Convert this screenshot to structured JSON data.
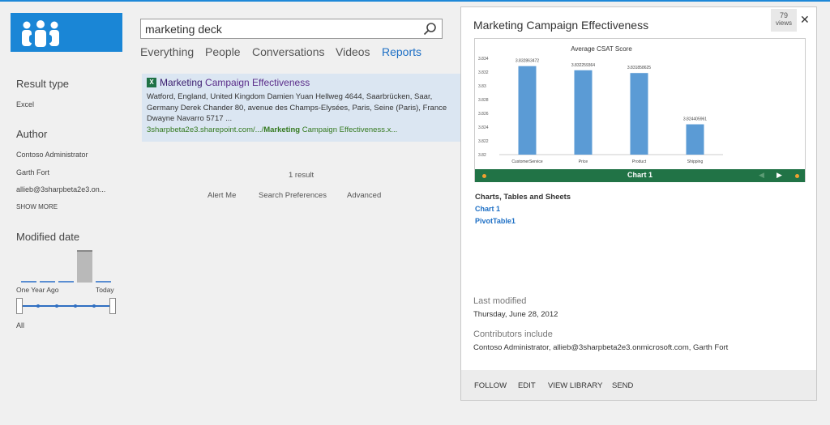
{
  "refiners": {
    "result_type": {
      "heading": "Result type",
      "items": [
        "Excel"
      ]
    },
    "author": {
      "heading": "Author",
      "items": [
        "Contoso Administrator",
        "Garth Fort",
        "allieb@3sharpbeta2e3.on..."
      ],
      "show_more": "SHOW MORE"
    },
    "modified_date": {
      "heading": "Modified date",
      "start_label": "One Year Ago",
      "end_label": "Today",
      "selection": "All",
      "histogram_levels": [
        0.05,
        0.05,
        0.05,
        0.95,
        0.05
      ]
    }
  },
  "search": {
    "query": "marketing deck"
  },
  "verticals": [
    "Everything",
    "People",
    "Conversations",
    "Videos",
    "Reports"
  ],
  "active_vertical": "Reports",
  "result": {
    "title_highlight": "Marketing",
    "title_rest": " Campaign Effectiveness",
    "summary": "Watford, England, United Kingdom Damien Yuan Hellweg 4644, Saarbrücken, Saar, Germany Derek Chander 80, avenue des Champs-Elysées, Paris, Seine (Paris), France Dwayne Navarro 5717 ...",
    "url_prefix": "3sharpbeta2e3.sharepoint.com/.../",
    "url_bold": "Marketing",
    "url_suffix": " Campaign Effectiveness.x..."
  },
  "result_count": "1 result",
  "footer_links": [
    "Alert Me",
    "Search Preferences",
    "Advanced"
  ],
  "preview": {
    "title": "Marketing Campaign Effectiveness",
    "views_count": "79",
    "views_label": "views",
    "chart_nav_label": "Chart 1",
    "section_heading": "Charts, Tables and Sheets",
    "links": [
      "Chart 1",
      "PivotTable1"
    ],
    "last_modified_label": "Last modified",
    "last_modified_value": "Thursday, June 28, 2012",
    "contributors_label": "Contributors include",
    "contributors_value": "Contoso Administrator, allieb@3sharpbeta2e3.onmicrosoft.com, Garth Fort",
    "actions": [
      "FOLLOW",
      "EDIT",
      "VIEW LIBRARY",
      "SEND"
    ]
  },
  "chart_data": {
    "type": "bar",
    "title": "Average CSAT Score",
    "categories": [
      "CustomerService",
      "Price",
      "Product",
      "Shipping"
    ],
    "values": [
      3.832863472,
      3.832259364,
      3.831858625,
      3.824405961
    ],
    "value_labels": [
      "3.832863472",
      "3.832259364",
      "3.831858625",
      "3.824405961"
    ],
    "ylim": [
      3.82,
      3.834
    ],
    "yticks": [
      "3.834",
      "3.832",
      "3.83",
      "3.828",
      "3.826",
      "3.824",
      "3.822",
      "3.82"
    ],
    "color": "#5b9bd5"
  }
}
